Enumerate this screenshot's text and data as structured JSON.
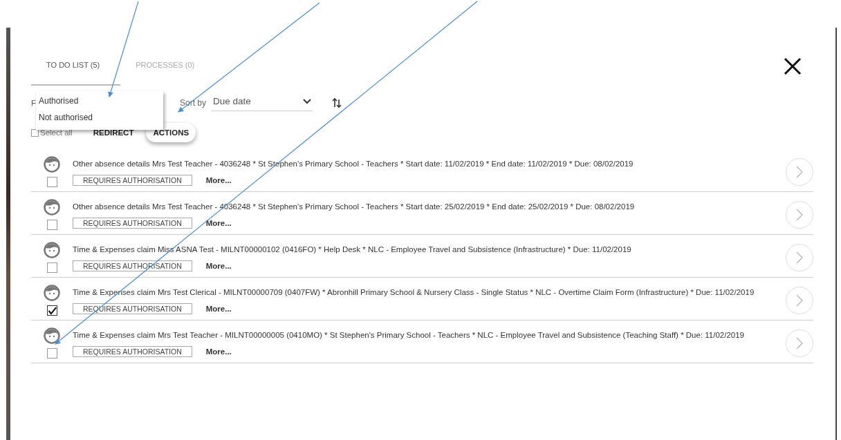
{
  "tabs": [
    {
      "label": "TO DO LIST (5)",
      "selected": true
    },
    {
      "label": "PROCESSES (0)",
      "selected": false
    }
  ],
  "filter": {
    "label": "F",
    "menu": [
      "Authorised",
      "Not authorised"
    ]
  },
  "sort": {
    "label": "Sort by",
    "value": "Due date"
  },
  "select_all": {
    "label": "Select all",
    "checked": false
  },
  "buttons": [
    {
      "label": "REDIRECT",
      "highlighted": false
    },
    {
      "label": "ACTIONS",
      "highlighted": true
    }
  ],
  "tasks": [
    {
      "text": "Other absence details Mrs Test Teacher - 4036248 * St Stephen's Primary School - Teachers * Start date: 11/02/2019 * End date: 11/02/2019 * Due: 08/02/2019",
      "status": "REQUIRES AUTHORISATION",
      "more": "More...",
      "checked": false
    },
    {
      "text": "Other absence details Mrs Test Teacher - 4036248 * St Stephen's Primary School - Teachers * Start date: 25/02/2019 * End date: 25/02/2019 * Due: 08/02/2019",
      "status": "REQUIRES AUTHORISATION",
      "more": "More...",
      "checked": false
    },
    {
      "text": "Time & Expenses claim Miss ASNA Test - MILNT00000102 (0416FO) * Help Desk * NLC - Employee Travel and Subsistence (Infrastructure) * Due: 11/02/2019",
      "status": "REQUIRES AUTHORISATION",
      "more": "More...",
      "checked": false
    },
    {
      "text": "Time & Expenses claim Mrs Test Clerical - MILNT00000709 (0407FW) * Abronhill Primary School & Nursery Class - Single Status * NLC - Overtime Claim Form (Infrastructure) * Due: 11/02/2019",
      "status": "REQUIRES AUTHORISATION",
      "more": "More...",
      "checked": true
    },
    {
      "text": "Time & Expenses claim Mrs Test Teacher - MILNT00000005 (0410MO) * St Stephen's Primary School - Teachers * NLC - Employee Travel and Subsistence (Teaching Staff) * Due: 11/02/2019",
      "status": "REQUIRES AUTHORISATION",
      "more": "More...",
      "checked": false
    }
  ]
}
